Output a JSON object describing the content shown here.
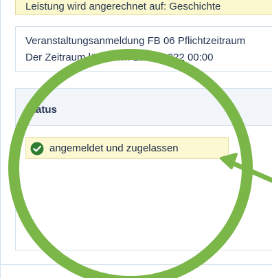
{
  "info_strip": {
    "text": "Leistung wird angerechnet auf: Geschichte"
  },
  "registration": {
    "line1": "Veranstaltungsanmeldung FB 06 Pflichtzeitraum",
    "line2": "Der Zeitraum läuft vom 22.06.2022 00:00"
  },
  "status": {
    "title": "Status",
    "value": "angemeldet und zugelassen",
    "icon": "check-circle-icon"
  },
  "colors": {
    "accent_green": "#7ab648",
    "badge_bg": "#fbf8d2",
    "check_green": "#2e7d32",
    "panel_border": "#d4e1ec",
    "header_bg": "#f2f6fa"
  }
}
